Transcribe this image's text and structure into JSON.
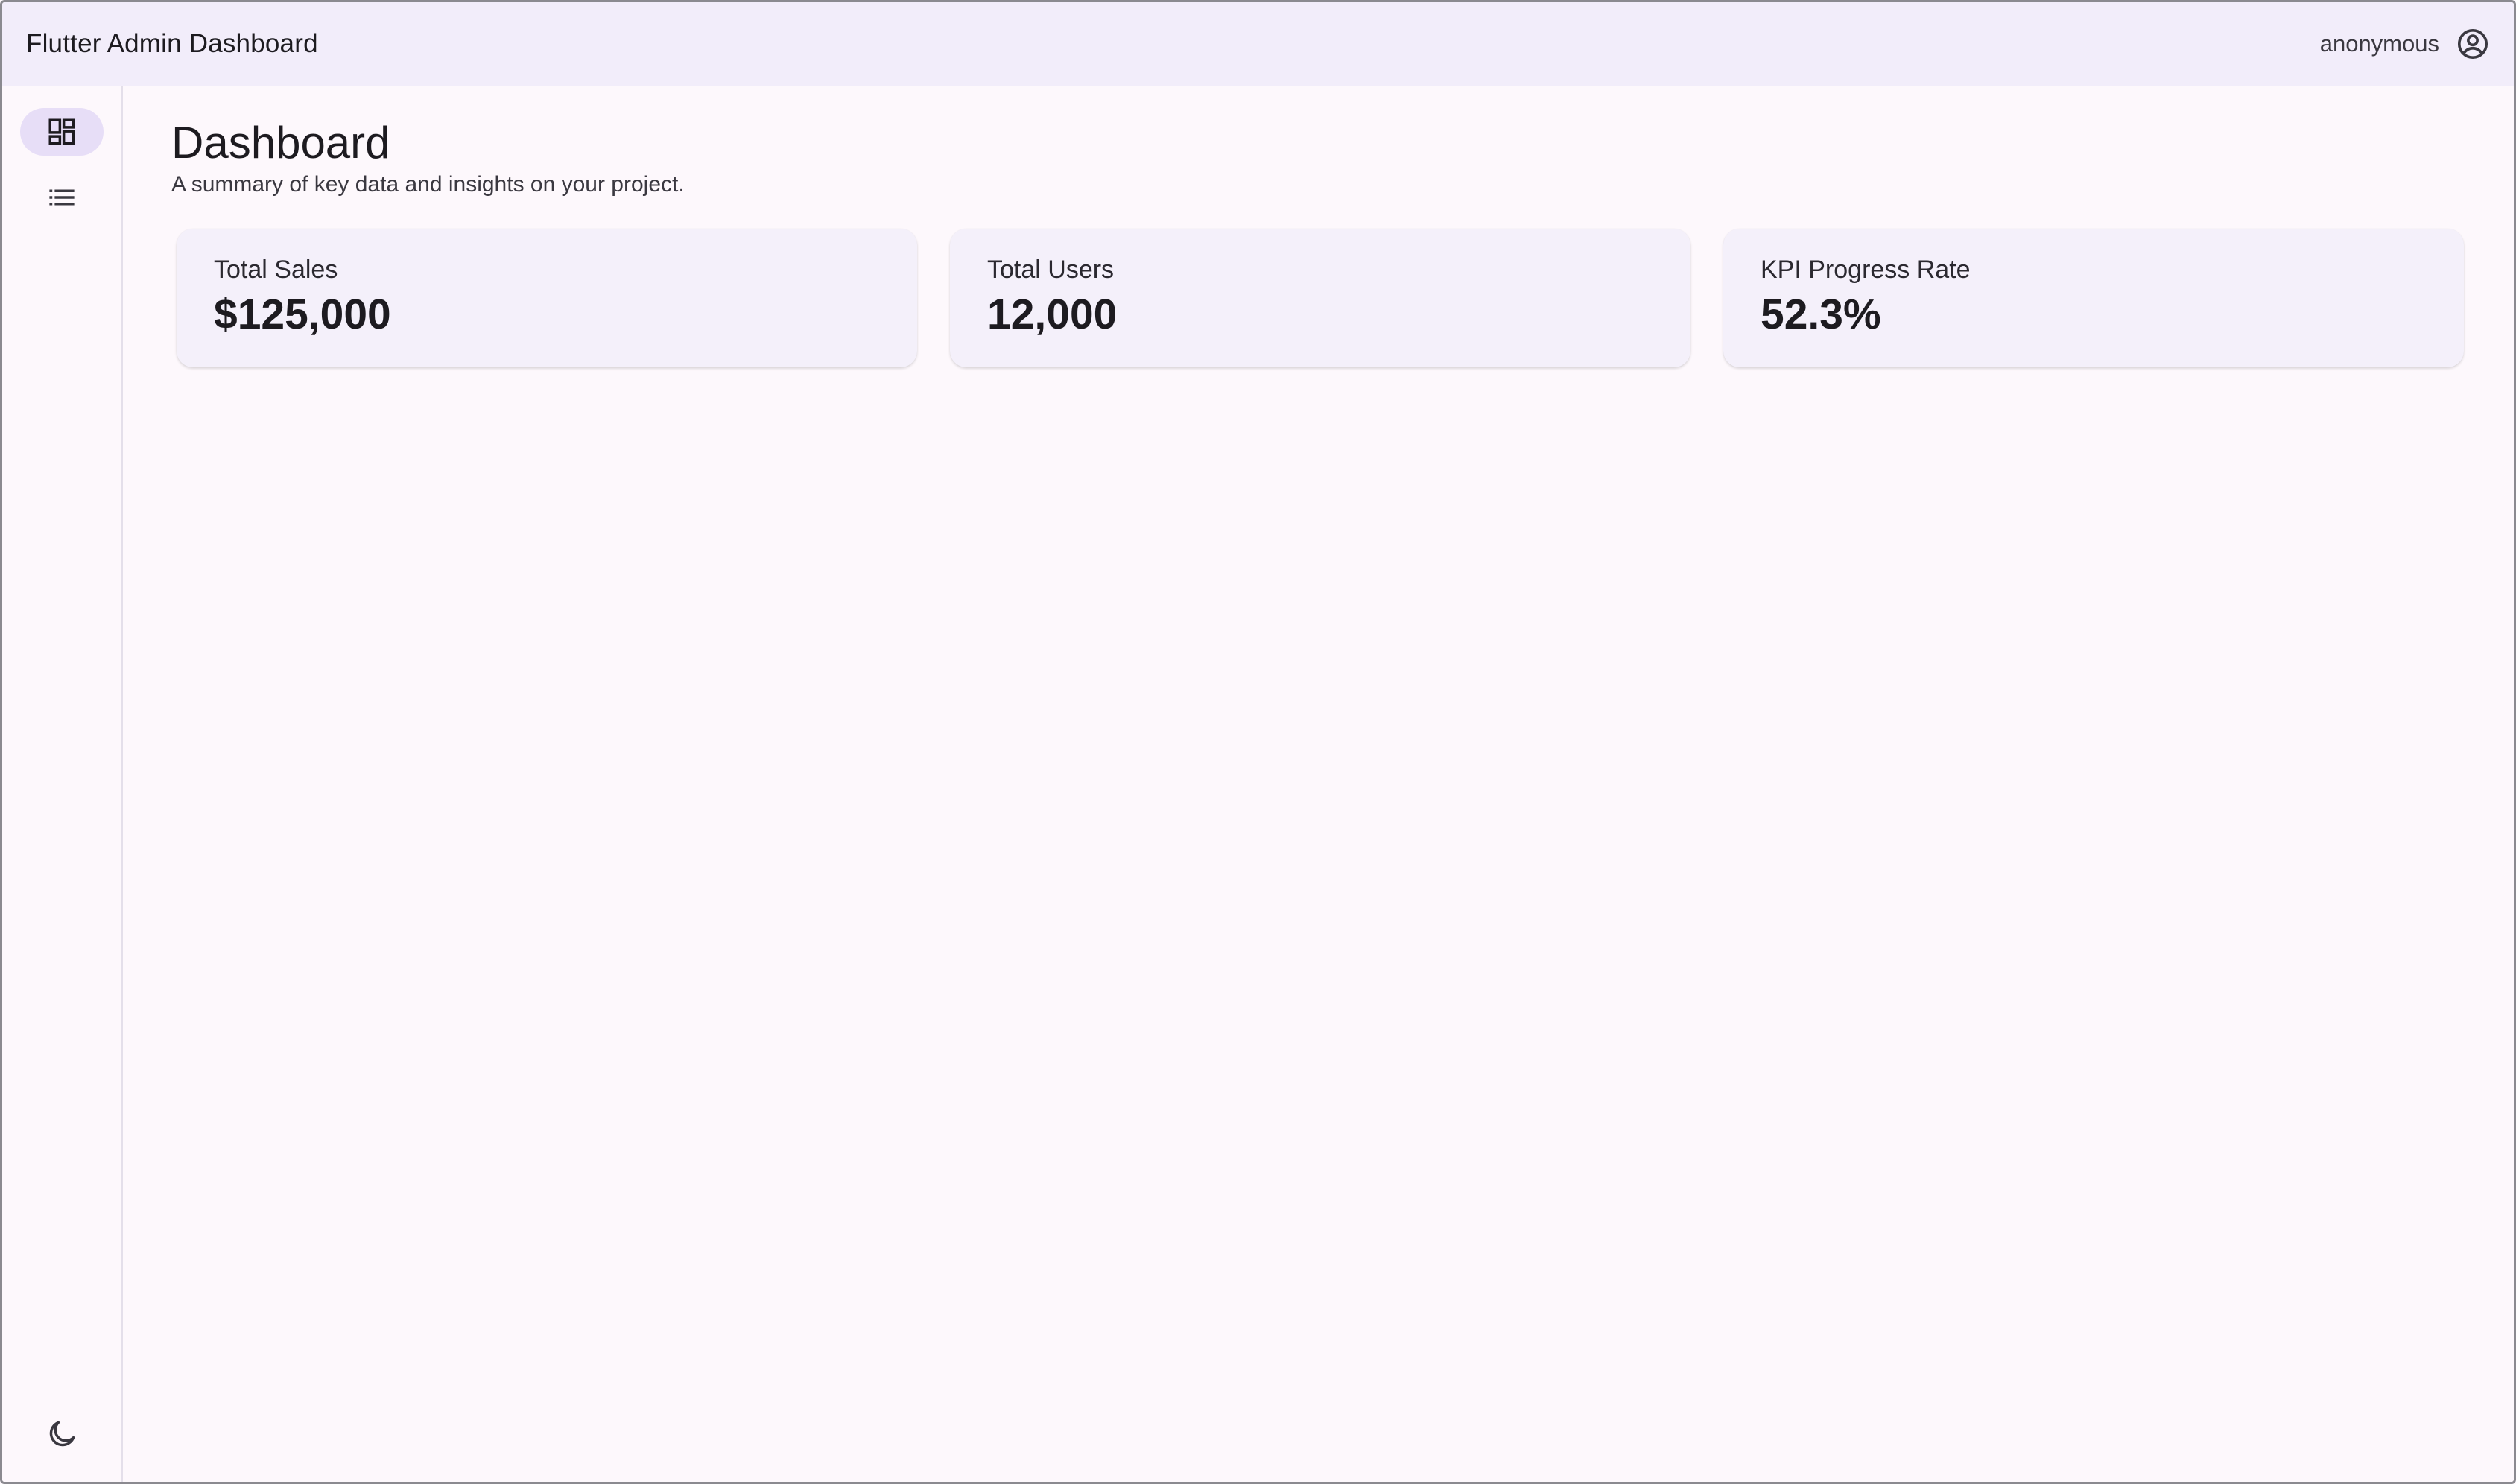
{
  "appbar": {
    "title": "Flutter Admin Dashboard",
    "user_name": "anonymous",
    "user_icon": "account-circle-icon"
  },
  "rail": {
    "items": [
      {
        "icon": "dashboard-icon",
        "selected": true
      },
      {
        "icon": "list-icon",
        "selected": false
      }
    ],
    "theme_toggle_icon": "moon-icon"
  },
  "main": {
    "title": "Dashboard",
    "subtitle": "A summary of key data and insights on your project.",
    "cards": [
      {
        "label": "Total Sales",
        "value": "$125,000"
      },
      {
        "label": "Total Users",
        "value": "12,000"
      },
      {
        "label": "KPI Progress Rate",
        "value": "52.3%"
      }
    ]
  },
  "colors": {
    "appbar_bg": "#f2edfa",
    "page_bg": "#fdf8fc",
    "card_bg": "#f4f0fa",
    "rail_selected_bg": "#e7def7",
    "text": "#1d1b20"
  }
}
